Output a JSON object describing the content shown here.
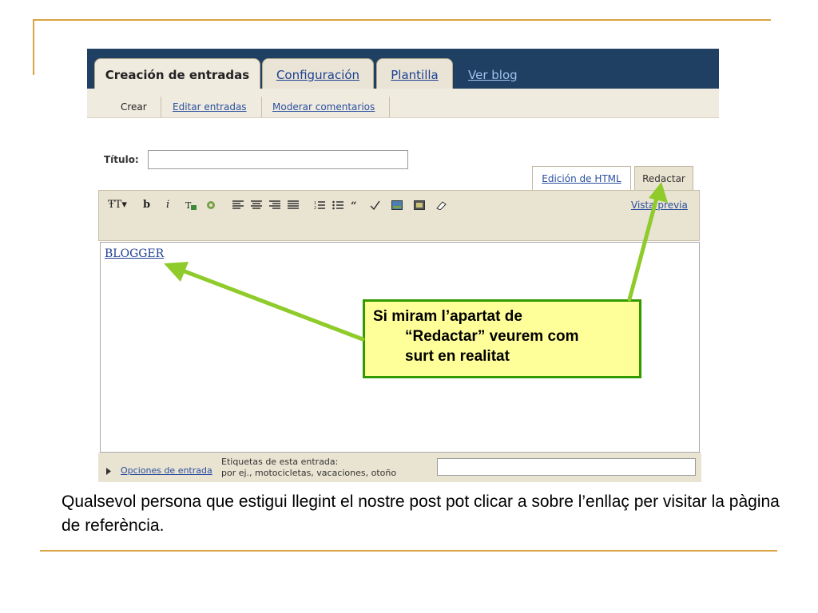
{
  "blogger": {
    "main_tabs": [
      {
        "label": "Creación de entradas"
      },
      {
        "label": "Configuración"
      },
      {
        "label": "Plantilla"
      }
    ],
    "view_blog": "Ver blog",
    "sub_tabs": [
      {
        "label": "Crear"
      },
      {
        "label": "Editar entradas"
      },
      {
        "label": "Moderar comentarios"
      }
    ],
    "title_label": "Título:",
    "title_value": "",
    "mode_tabs": [
      {
        "label": "Edición de HTML"
      },
      {
        "label": "Redactar"
      }
    ],
    "toolbar": {
      "font": "ŦT▾",
      "bold": "b",
      "italic": "i",
      "preview": "Vista previa"
    },
    "editor_link": "BLOGGER",
    "options_link": "Opciones de entrada",
    "labels_title": "Etiquetas de esta entrada:",
    "labels_hint": "por ej., motocicletas, vacaciones, otoño",
    "labels_value": ""
  },
  "callout": {
    "line1": "Si miram l’apartat de",
    "line2": "“Redactar” veurem com",
    "line3": "surt en realitat"
  },
  "caption": "Qualsevol persona que estigui llegint el nostre post pot clicar a sobre l’enllaç per visitar la pàgina de referència.",
  "colors": {
    "accent_line": "#d9a441",
    "arrow": "#8fcb2a",
    "callout_bg": "#ffff99",
    "callout_border": "#339900"
  }
}
